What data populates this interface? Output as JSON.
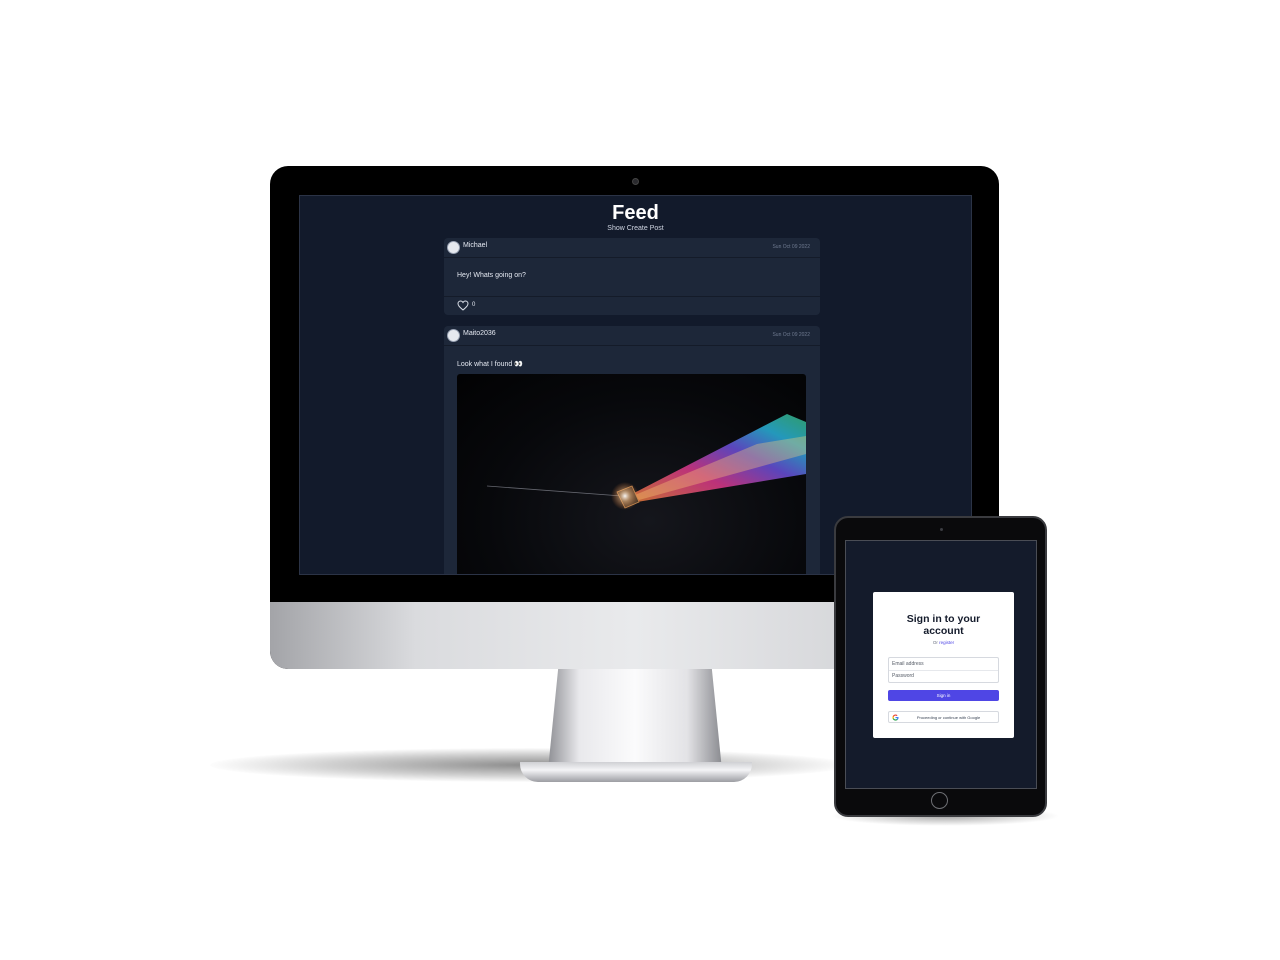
{
  "desktop": {
    "feed": {
      "title": "Feed",
      "toggle_label": "Show Create Post"
    },
    "posts": [
      {
        "author": "Michael",
        "date": "Sun Oct 09 2022",
        "text": "Hey! Whats going on?",
        "likes": "0"
      },
      {
        "author": "Maito2036",
        "date": "Sun Oct 09 2022",
        "text": "Look what I found 👀"
      }
    ]
  },
  "tablet": {
    "signin": {
      "title_line1": "Sign in to your",
      "title_line2": "account",
      "or_text": "Or",
      "register_link": "register",
      "email_placeholder": "Email address",
      "password_placeholder": "Password",
      "submit_label": "Sign in",
      "google_label": "Proceeding or continue with Google"
    }
  },
  "colors": {
    "screen_background": "#121a2b",
    "card_background": "#1d2739",
    "accent": "#4f46e5"
  }
}
